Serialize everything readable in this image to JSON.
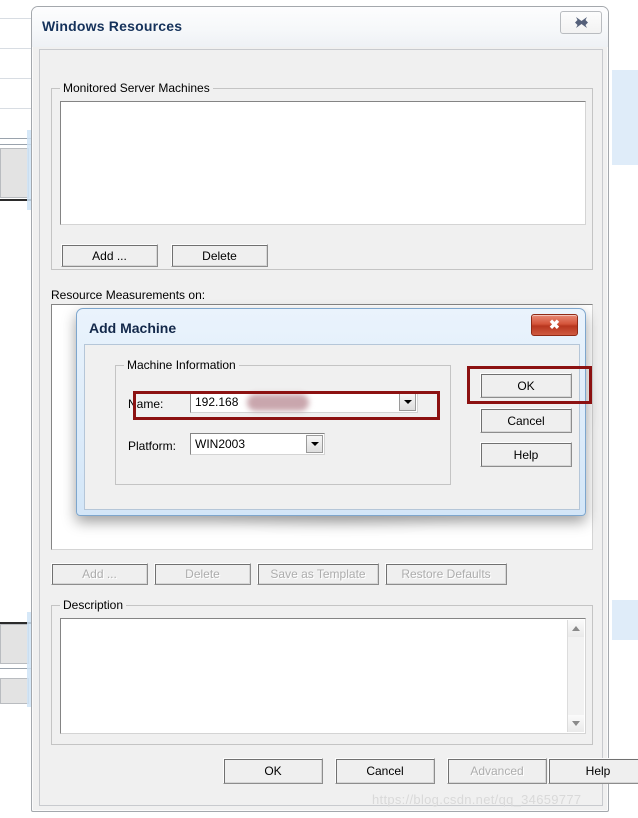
{
  "window": {
    "title": "Windows Resources",
    "close_icon": "close-x-icon"
  },
  "monitored_group": {
    "legend": "Monitored Server Machines",
    "list_items": [],
    "buttons": [
      {
        "label": "Add ...",
        "name": "add-machine-button",
        "enabled": true
      },
      {
        "label": "Delete",
        "name": "delete-machine-button",
        "enabled": true
      }
    ]
  },
  "measurements": {
    "label": "Resource Measurements on:",
    "items": [],
    "buttons": [
      {
        "label": "Add ...",
        "name": "add-measurement-button",
        "enabled": false
      },
      {
        "label": "Delete",
        "name": "delete-measurement-button",
        "enabled": false
      },
      {
        "label": "Save as Template",
        "name": "save-as-template-button",
        "enabled": false
      },
      {
        "label": "Restore Defaults",
        "name": "restore-defaults-button",
        "enabled": false
      }
    ]
  },
  "description": {
    "legend": "Description",
    "value": "",
    "scroll_up_icon": "triangle-up-icon",
    "scroll_down_icon": "triangle-down-icon"
  },
  "footer_buttons": [
    {
      "label": "OK",
      "name": "ok-button",
      "enabled": true
    },
    {
      "label": "Cancel",
      "name": "cancel-button",
      "enabled": true
    },
    {
      "label": "Advanced",
      "name": "advanced-button",
      "enabled": false
    },
    {
      "label": "Help",
      "name": "help-button",
      "enabled": true
    }
  ],
  "add_machine_dialog": {
    "title": "Add Machine",
    "close_icon": "close-x-icon",
    "group_legend": "Machine Information",
    "name_label": "Name:",
    "name_value": "192.168",
    "name_dropdown_icon": "chevron-down-icon",
    "platform_label": "Platform:",
    "platform_value": "WIN2003",
    "platform_dropdown_icon": "chevron-down-icon",
    "buttons": [
      {
        "label": "OK",
        "name": "dialog-ok-button",
        "enabled": true
      },
      {
        "label": "Cancel",
        "name": "dialog-cancel-button",
        "enabled": true
      },
      {
        "label": "Help",
        "name": "dialog-help-button",
        "enabled": true
      }
    ]
  },
  "annotations": {
    "color": "#8c1111",
    "highlight_name_field": true,
    "highlight_ok_button": true
  },
  "watermark": "https://blog.csdn.net/qq_34659777",
  "colors": {
    "window_face": "#f0f0f0",
    "title_text": "#15325b",
    "modal_header": "#d3e6f8",
    "modal_close": "#b8361f",
    "annotation_red": "#8c1111",
    "redaction": "#c9a6ad"
  }
}
